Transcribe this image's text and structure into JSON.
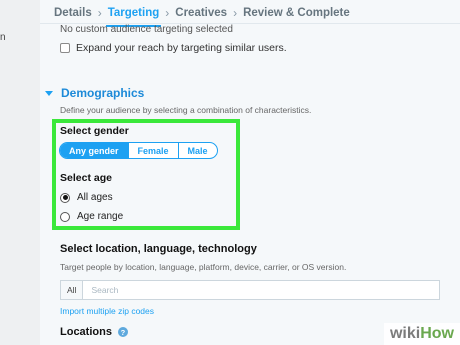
{
  "left_fragment": "n",
  "breadcrumbs": [
    {
      "label": "Details"
    },
    {
      "label": "Targeting",
      "active": true
    },
    {
      "label": "Creatives"
    },
    {
      "label": "Review & Complete"
    }
  ],
  "audience": {
    "cut_text": "No custom audience targeting selected",
    "expand_label": "Expand your reach by targeting similar users."
  },
  "demographics": {
    "title": "Demographics",
    "description": "Define your audience by selecting a combination of characteristics.",
    "gender_label": "Select gender",
    "gender_options": [
      "Any gender",
      "Female",
      "Male"
    ],
    "gender_selected": "Any gender",
    "age_label": "Select age",
    "age_options": [
      "All ages",
      "Age range"
    ],
    "age_selected": "All ages"
  },
  "location": {
    "title": "Select location, language, technology",
    "description": "Target people by location, language, platform, device, carrier, or OS version.",
    "filter_label": "All",
    "search_placeholder": "Search",
    "zip_link": "Import multiple zip codes",
    "locations_label": "Locations",
    "help_icon_glyph": "?"
  },
  "watermark": {
    "part1": "wiki",
    "part2": "How"
  },
  "colors": {
    "accent": "#1da1f2",
    "highlight": "#3ae83a"
  }
}
